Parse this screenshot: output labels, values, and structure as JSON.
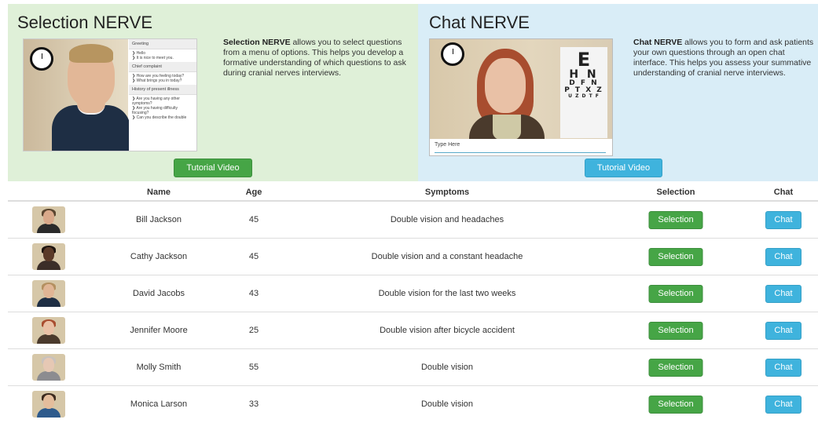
{
  "selection_panel": {
    "title": "Selection NERVE",
    "desc_bold": "Selection NERVE",
    "desc_rest": " allows you to select questions from a menu of options. This helps you develop a formative understanding of which questions to ask during cranial nerves interviews.",
    "tutorial_label": "Tutorial Video",
    "bg_color": "#dff0d8",
    "menu": {
      "greeting_header": "Greeting",
      "greeting_items": [
        "Hello",
        "It is nice to meet you."
      ],
      "complaint_header": "Chief complaint",
      "complaint_items": [
        "How are you feeling today?",
        "What brings you in today?"
      ],
      "history_header": "History of present illness",
      "history_items": [
        "Are you having any other symptoms?",
        "Are you having difficulty focusing?",
        "Can you describe the double"
      ]
    }
  },
  "chat_panel": {
    "title": "Chat NERVE",
    "desc_bold": "Chat NERVE",
    "desc_rest": " allows you to form and ask patients your own questions through an open chat interface. This helps you assess your summative understanding of cranial nerve interviews.",
    "tutorial_label": "Tutorial Video",
    "bg_color": "#d9edf7",
    "input_placeholder": "Type Here",
    "eye_chart": [
      "E",
      "H N",
      "D F N",
      "P T X Z",
      "U Z D T F"
    ]
  },
  "table": {
    "headers": {
      "name": "Name",
      "age": "Age",
      "symptoms": "Symptoms",
      "selection": "Selection",
      "chat": "Chat"
    },
    "rows": [
      {
        "name": "Bill Jackson",
        "age": "45",
        "symptoms": "Double vision and headaches",
        "selection_label": "Selection",
        "chat_label": "Chat",
        "avatar": {
          "skin": "#d9a98a",
          "hair": "#5a4630",
          "shirt": "#2a2a2a"
        }
      },
      {
        "name": "Cathy Jackson",
        "age": "45",
        "symptoms": "Double vision and a constant headache",
        "selection_label": "Selection",
        "chat_label": "Chat",
        "avatar": {
          "skin": "#5b3a28",
          "hair": "#1e140e",
          "shirt": "#3b2e28"
        }
      },
      {
        "name": "David Jacobs",
        "age": "43",
        "symptoms": "Double vision for the last two weeks",
        "selection_label": "Selection",
        "chat_label": "Chat",
        "avatar": {
          "skin": "#e0b595",
          "hair": "#b49060",
          "shirt": "#1e2e44"
        }
      },
      {
        "name": "Jennifer Moore",
        "age": "25",
        "symptoms": "Double vision after bicycle accident",
        "selection_label": "Selection",
        "chat_label": "Chat",
        "avatar": {
          "skin": "#e9c1a6",
          "hair": "#a84d2f",
          "shirt": "#4a3a2c"
        }
      },
      {
        "name": "Molly Smith",
        "age": "55",
        "symptoms": "Double vision",
        "selection_label": "Selection",
        "chat_label": "Chat",
        "avatar": {
          "skin": "#e6c8b4",
          "hair": "#c9c2bd",
          "shirt": "#8c8c90"
        }
      },
      {
        "name": "Monica Larson",
        "age": "33",
        "symptoms": "Double vision",
        "selection_label": "Selection",
        "chat_label": "Chat",
        "avatar": {
          "skin": "#e4bd9c",
          "hair": "#3c2a1e",
          "shirt": "#2d5a8c"
        }
      }
    ]
  },
  "colors": {
    "selection_button": "#46a546",
    "chat_button": "#3fb3dd"
  }
}
